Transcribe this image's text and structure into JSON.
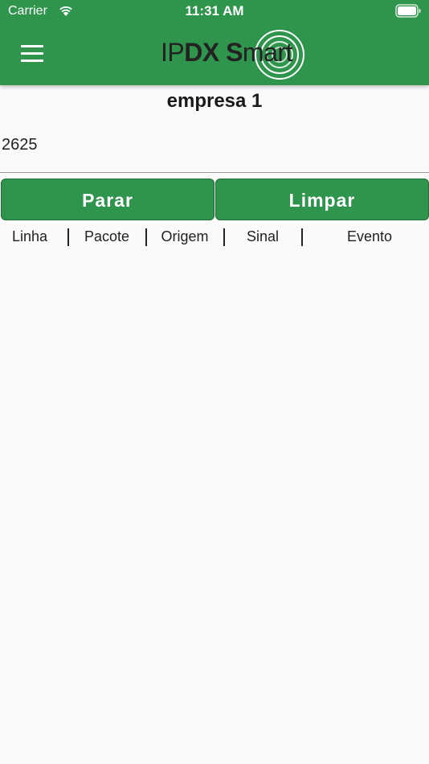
{
  "status_bar": {
    "carrier": "Carrier",
    "time": "11:31 AM",
    "icons": [
      "wifi-icon",
      "battery-icon"
    ]
  },
  "app_bar": {
    "menu_icon": "menu-icon",
    "logo": {
      "text_light": "IP",
      "text_bold_1": "DX",
      "text_bold_2": "S",
      "text_light_2": "mart"
    },
    "background_color": "#2f944c"
  },
  "main": {
    "company": "empresa 1",
    "value": "2625",
    "buttons": {
      "stop_label": "Parar",
      "clear_label": "Limpar",
      "color": "#2f944c"
    },
    "table": {
      "columns": [
        "Linha",
        "Pacote",
        "Origem",
        "Sinal",
        "Evento"
      ]
    }
  }
}
